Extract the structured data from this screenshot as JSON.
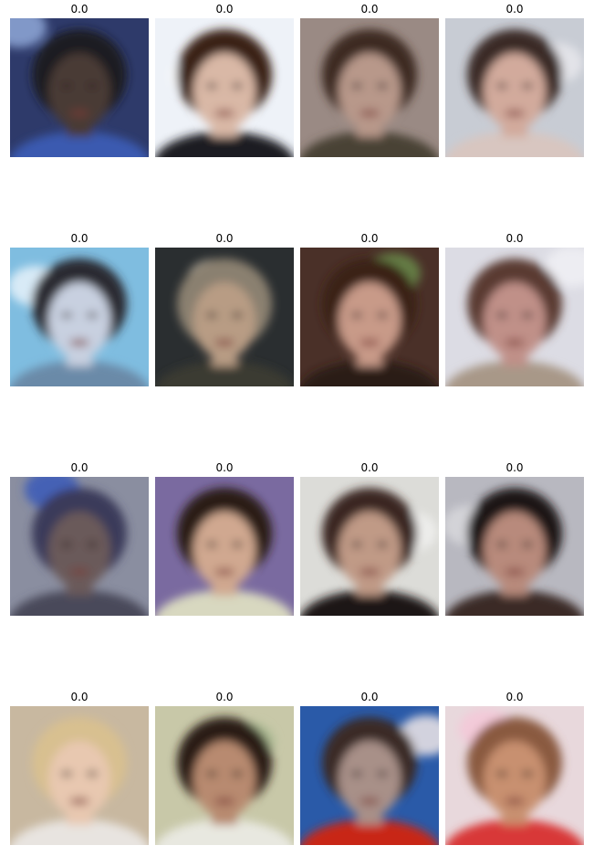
{
  "figure": {
    "images": [
      {
        "title": "0.0",
        "palette": {
          "bg": "#2e3a6a",
          "hair": "#1a1a22",
          "skin": "#4a3a34",
          "cloth": "#3a5ab0",
          "accent": "#8fa8d8"
        }
      },
      {
        "title": "0.0",
        "palette": {
          "bg": "#eef2f8",
          "hair": "#3a2418",
          "skin": "#d9b8a6",
          "cloth": "#1c1c20",
          "accent": "#ffffff"
        }
      },
      {
        "title": "0.0",
        "palette": {
          "bg": "#9a8a84",
          "hair": "#3c2a22",
          "skin": "#b8988a",
          "cloth": "#4a4236",
          "accent": "#d8d0ce"
        }
      },
      {
        "title": "0.0",
        "palette": {
          "bg": "#c8ccd4",
          "hair": "#3a2a26",
          "skin": "#d2aa9c",
          "cloth": "#d8c6c0",
          "accent": "#e8e8ec"
        }
      },
      {
        "title": "0.0",
        "palette": {
          "bg": "#7fbde0",
          "hair": "#2a2a30",
          "skin": "#c8d0e0",
          "cloth": "#6a8aa8",
          "accent": "#e8f2fa"
        }
      },
      {
        "title": "0.0",
        "palette": {
          "bg": "#2a2e30",
          "hair": "#8a8070",
          "skin": "#b89c84",
          "cloth": "#3a3a30",
          "accent": "#c8c0b0"
        }
      },
      {
        "title": "0.0",
        "palette": {
          "bg": "#4a3028",
          "hair": "#3a2418",
          "skin": "#c89a88",
          "cloth": "#2a1c18",
          "accent": "#6a8a4a"
        }
      },
      {
        "title": "0.0",
        "palette": {
          "bg": "#dcdce4",
          "hair": "#5a3a30",
          "skin": "#c09088",
          "cloth": "#a89888",
          "accent": "#f0f0f4"
        }
      },
      {
        "title": "0.0",
        "palette": {
          "bg": "#8a8ea0",
          "hair": "#3a3a5a",
          "skin": "#6a5a5a",
          "cloth": "#484a5a",
          "accent": "#3a5ab8"
        }
      },
      {
        "title": "0.0",
        "palette": {
          "bg": "#7a6aa0",
          "hair": "#2a1a18",
          "skin": "#d0a890",
          "cloth": "#d8d8c0",
          "accent": "#9a5ac8"
        }
      },
      {
        "title": "0.0",
        "palette": {
          "bg": "#dcdcd8",
          "hair": "#3a2820",
          "skin": "#c09a86",
          "cloth": "#1a1818",
          "accent": "#f0f0ee"
        }
      },
      {
        "title": "0.0",
        "palette": {
          "bg": "#b8b8c0",
          "hair": "#1a1416",
          "skin": "#b88a7c",
          "cloth": "#3a2a28",
          "accent": "#d8d8dc"
        }
      },
      {
        "title": "0.0",
        "palette": {
          "bg": "#c8b8a0",
          "hair": "#d8c090",
          "skin": "#e8c8b0",
          "cloth": "#e8e4e0",
          "accent": "#8a6a4a"
        }
      },
      {
        "title": "0.0",
        "palette": {
          "bg": "#c8c8a8",
          "hair": "#2a1a18",
          "skin": "#b88a70",
          "cloth": "#e8e8e0",
          "accent": "#a8b890"
        }
      },
      {
        "title": "0.0",
        "palette": {
          "bg": "#2a5aa8",
          "hair": "#3a2a28",
          "skin": "#a89088",
          "cloth": "#c82818",
          "accent": "#f0e8e8"
        }
      },
      {
        "title": "0.0",
        "palette": {
          "bg": "#e8d8dc",
          "hair": "#8a5a40",
          "skin": "#c89070",
          "cloth": "#d83838",
          "accent": "#f4c8d8"
        }
      }
    ]
  }
}
